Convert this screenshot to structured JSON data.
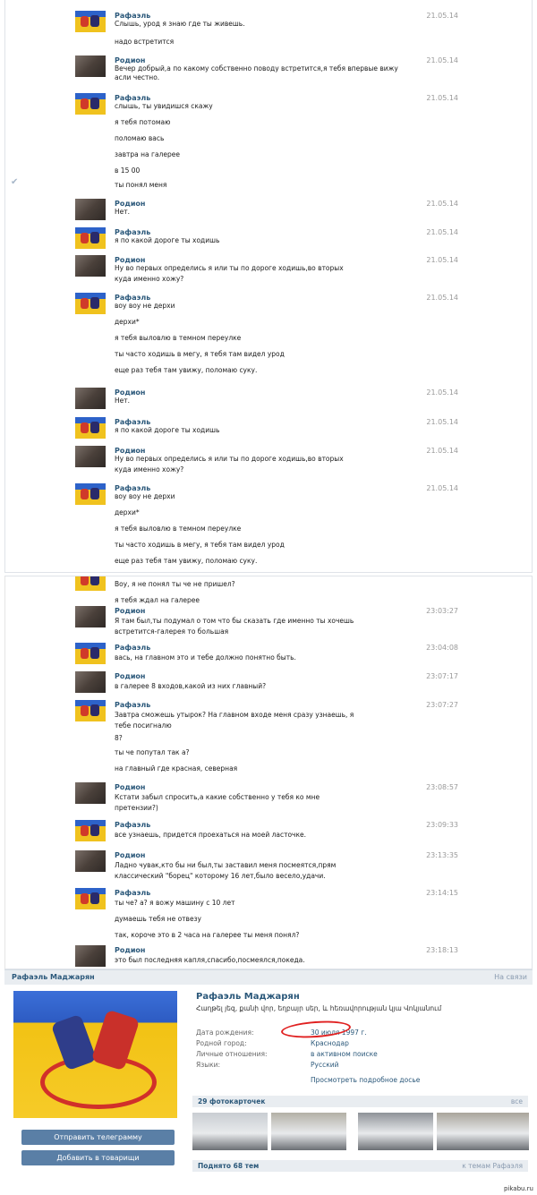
{
  "panel1": {
    "messages": [
      {
        "sender": "raf",
        "name": "Рафаэль",
        "time": "21.05.14",
        "lines": [
          "Слышь, урод я знаю где ты живешь.",
          "надо встретится"
        ]
      },
      {
        "sender": "rod",
        "name": "Родион",
        "time": "21.05.14",
        "lines": [
          "Вечер добрый,а по какому собственно поводу встретится,я тебя впервые вижу асли честно."
        ]
      },
      {
        "sender": "raf",
        "name": "Рафаэль",
        "time": "21.05.14",
        "lines": [
          "слышь, ты увидишся скажу",
          "я тебя потомаю",
          "поломаю вась",
          "завтра на галерее",
          "в 15 00",
          "ты понял меня"
        ]
      },
      {
        "sender": "rod",
        "name": "Родион",
        "time": "21.05.14",
        "lines": [
          "Нет."
        ]
      },
      {
        "sender": "raf",
        "name": "Рафаэль",
        "time": "21.05.14",
        "lines": [
          "я по какой дороге ты ходишь"
        ]
      },
      {
        "sender": "rod",
        "name": "Родион",
        "time": "21.05.14",
        "lines": [
          "Ну во первых определись я или ты по дороге ходишь,во вторых",
          "куда именно хожу?"
        ]
      },
      {
        "sender": "raf",
        "name": "Рафаэль",
        "time": "21.05.14",
        "lines": [
          "воу воу не дерхи",
          "дерхи*",
          "я тебя выловлю в темном переулке",
          "ты часто ходишь в мегу, я тебя там видел урод",
          "еще раз тебя там увижу, поломаю суку."
        ]
      },
      {
        "sender": "rod",
        "name": "Родион",
        "time": "21.05.14",
        "lines": [
          "Нет."
        ]
      },
      {
        "sender": "raf",
        "name": "Рафаэль",
        "time": "21.05.14",
        "lines": [
          "я по какой дороге ты ходишь"
        ]
      },
      {
        "sender": "rod",
        "name": "Родион",
        "time": "21.05.14",
        "lines": [
          "Ну во первых определись я или ты по дороге ходишь,во вторых",
          "куда именно хожу?"
        ]
      },
      {
        "sender": "raf",
        "name": "Рафаэль",
        "time": "21.05.14",
        "lines": [
          "воу воу не дерхи",
          "дерхи*",
          "я тебя выловлю в темном переулке",
          "ты часто ходишь в мегу, я тебя там видел урод",
          "еще раз тебя там увижу, поломаю суку."
        ]
      }
    ]
  },
  "panel2": {
    "messages": [
      {
        "sender": "raf",
        "name": "",
        "time": "",
        "lines": [
          "Воу, я не понял ты че не пришел?",
          "я тебя ждал на галерее"
        ]
      },
      {
        "sender": "rod",
        "name": "Родион",
        "time": "23:03:27",
        "lines": [
          "Я там был,ты подумал о том что бы сказать где именно ты хочешь",
          "встретится-галерея то большая"
        ]
      },
      {
        "sender": "raf",
        "name": "Рафаэль",
        "time": "23:04:08",
        "lines": [
          "вась, на главном это и тебе должно понятно быть."
        ]
      },
      {
        "sender": "rod",
        "name": "Родион",
        "time": "23:07:17",
        "lines": [
          "в галерее 8 входов,какой из них главный?"
        ]
      },
      {
        "sender": "raf",
        "name": "Рафаэль",
        "time": "23:07:27",
        "lines": [
          "Завтра сможешь утырок? На главном входе меня сразу узнаешь, я",
          "тебе посигналю",
          "8?",
          "ты че попутал так а?",
          "на главный где красная, северная"
        ]
      },
      {
        "sender": "rod",
        "name": "Родион",
        "time": "23:08:57",
        "lines": [
          "Кстати забыл спросить,а какие собственно у тебя ко мне",
          "претензии?)"
        ]
      },
      {
        "sender": "raf",
        "name": "Рафаэль",
        "time": "23:09:33",
        "lines": [
          "все узнаешь, придется проехаться на моей ласточке."
        ]
      },
      {
        "sender": "rod",
        "name": "Родион",
        "time": "23:13:35",
        "lines": [
          "Ладно чувак,кто бы ни был,ты заставил меня посмеятся,прям",
          "классический \"борец\" которому 16 лет,было весело,удачи."
        ]
      },
      {
        "sender": "raf",
        "name": "Рафаэль",
        "time": "23:14:15",
        "lines": [
          "ты че? а? я вожу машину с 10 лет",
          "думаешь тебя не отвезу",
          "так, короче это в 2 часа на галерее ты меня понял?"
        ]
      },
      {
        "sender": "rod",
        "name": "Родион",
        "time": "23:18:13",
        "lines": [
          "это был последняя капля,спасибо,посмеялся,покеда."
        ]
      }
    ]
  },
  "profile": {
    "header_name": "Рафаэль Маджарян",
    "header_status": "На связи",
    "name": "Рафаэль Маджарян",
    "status": "Հաղթել յեզ, քանի վոր, եղբայր սեր, և հեռավորության կյա Վոկյանում",
    "rows": [
      {
        "label": "Дата рождения:",
        "value": "30 июля 1997 г."
      },
      {
        "label": "Родной город:",
        "value": "Краснодар"
      },
      {
        "label": "Личные отношения:",
        "value": "в активном поиске"
      },
      {
        "label": "Языки:",
        "value": "Русский"
      }
    ],
    "more_link": "Просмотреть подробное досье",
    "photos_title": "29 фотокарточек",
    "photos_all": "все",
    "posts_title": "Поднято 68 тем",
    "posts_link": "к темам Рафаэля",
    "btn_message": "Отправить телеграмму",
    "btn_friend": "Добавить в товарищи",
    "thumb_colors": [
      "#c9cdd2",
      "#b3b0a6",
      "#8e9298",
      "#a9a59b"
    ]
  },
  "watermark": "pikabu.ru"
}
